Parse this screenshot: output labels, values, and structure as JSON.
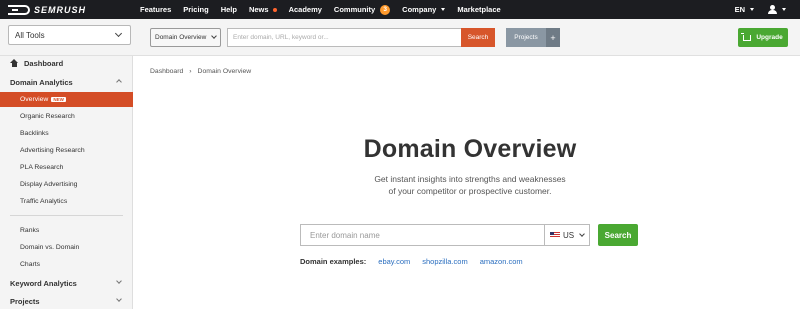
{
  "brand": {
    "logo_text": "SEMRUSH"
  },
  "topnav": {
    "items": [
      "Features",
      "Pricing",
      "Help",
      "News",
      "Academy",
      "Community",
      "Company",
      "Marketplace"
    ],
    "community_badge": "3",
    "language": "EN"
  },
  "toolbar": {
    "all_tools": "All Tools",
    "db_select": "Domain Overview",
    "search_placeholder": "Enter domain, URL, keyword or...",
    "search_button": "Search",
    "projects_button": "Projects",
    "plus_button": "+",
    "upgrade_button": "Upgrade"
  },
  "sidebar": {
    "dashboard": "Dashboard",
    "domain_analytics": "Domain Analytics",
    "items": [
      "Overview",
      "Organic Research",
      "Backlinks",
      "Advertising Research",
      "PLA Research",
      "Display Advertising",
      "Traffic Analytics"
    ],
    "new_tag": "NEW",
    "items2": [
      "Ranks",
      "Domain vs. Domain",
      "Charts"
    ],
    "keyword_analytics": "Keyword Analytics",
    "projects": "Projects"
  },
  "breadcrumb": {
    "home": "Dashboard",
    "separator": "›",
    "current": "Domain Overview"
  },
  "main": {
    "title": "Domain Overview",
    "subtitle_line1": "Get instant insights into strengths and weaknesses",
    "subtitle_line2": "of your competitor or prospective customer.",
    "input_placeholder": "Enter domain name",
    "country": "US",
    "search_button": "Search",
    "examples_label": "Domain examples:",
    "examples": [
      "ebay.com",
      "shopzilla.com",
      "amazon.com"
    ]
  },
  "colors": {
    "accent": "#d44d26",
    "green": "#4aa832",
    "topbar": "#1c1d21",
    "link": "#2a6ebf"
  }
}
